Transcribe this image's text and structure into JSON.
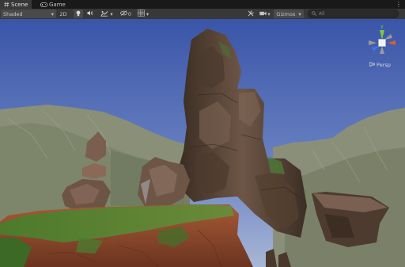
{
  "tabs": [
    {
      "label": "Scene",
      "icon": "hashtag-icon",
      "active": true
    },
    {
      "label": "Game",
      "icon": "gamepad-icon",
      "active": false
    }
  ],
  "toolbar": {
    "shading_mode": "Shaded",
    "mode_2d": "2D",
    "hidden_objects_count": "0",
    "gizmos_label": "Gizmos",
    "search_placeholder": "All"
  },
  "gizmo": {
    "y_label": "y",
    "projection_label": "Persp"
  },
  "colors": {
    "sky_top": "#3a55a8",
    "sky_bottom": "#8ea3cf",
    "axis_y": "#7ac943",
    "axis_x": "#e05a3a",
    "axis_z": "#3a78e0"
  }
}
